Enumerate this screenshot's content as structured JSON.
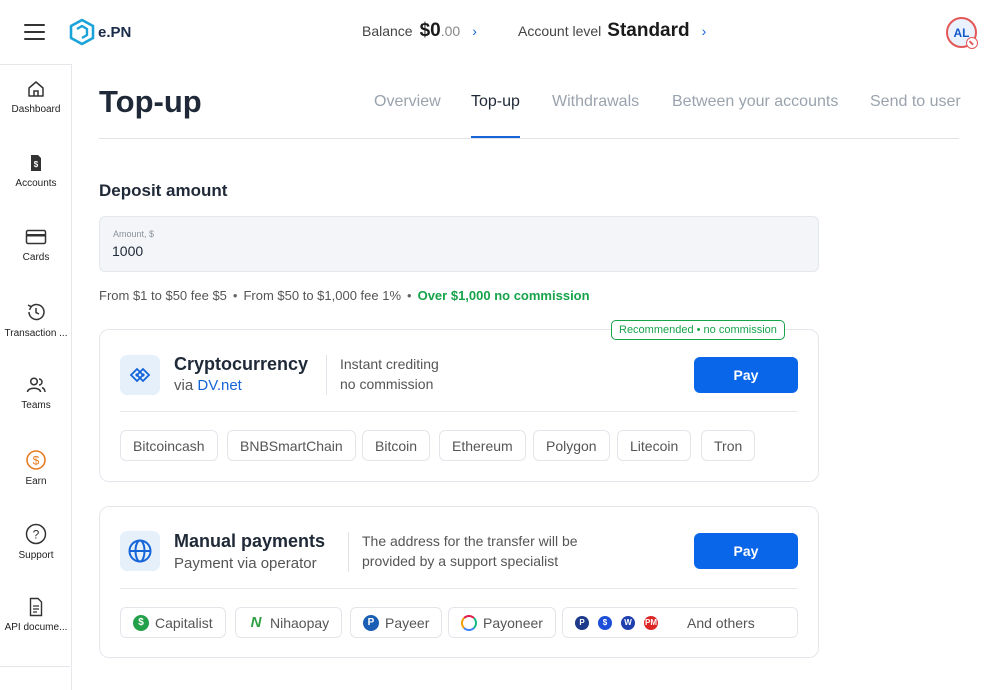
{
  "header": {
    "logo_text": "e.PN",
    "balance_label": "Balance",
    "balance_main": "$0",
    "balance_cents": ".00",
    "account_level_label": "Account level",
    "account_level_value": "Standard",
    "avatar_initials": "AL"
  },
  "sidebar": {
    "items": [
      {
        "label": "Dashboard",
        "icon": "home-icon"
      },
      {
        "label": "Accounts",
        "icon": "dollar-doc-icon"
      },
      {
        "label": "Cards",
        "icon": "card-icon"
      },
      {
        "label": "Transaction ...",
        "icon": "history-icon"
      },
      {
        "label": "Teams",
        "icon": "team-icon"
      },
      {
        "label": "Earn",
        "icon": "earn-dollar-icon"
      },
      {
        "label": "Support",
        "icon": "help-icon"
      },
      {
        "label": "API docume...",
        "icon": "document-icon"
      }
    ]
  },
  "page": {
    "title": "Top-up",
    "tabs": [
      "Overview",
      "Top-up",
      "Withdrawals",
      "Between your accounts",
      "Send to user"
    ],
    "active_tab": "Top-up"
  },
  "deposit": {
    "title": "Deposit amount",
    "amount_label": "Amount, $",
    "amount_value": "1000",
    "fee_1": "From $1 to $50 fee $5",
    "fee_2": "From $50 to $1,000 fee 1%",
    "fee_3": "Over $1,000 no commission"
  },
  "crypto": {
    "badge": "Recommended • no commission",
    "title": "Cryptocurrency",
    "via": "via",
    "via_link": "DV.net",
    "desc_1": "Instant crediting",
    "desc_2": "no commission",
    "pay_label": "Pay",
    "chips": [
      "Bitcoincash",
      "BNBSmartChain",
      "Bitcoin",
      "Ethereum",
      "Polygon",
      "Litecoin",
      "Tron"
    ]
  },
  "manual": {
    "title": "Manual payments",
    "subtitle": "Payment via operator",
    "desc_1": "The address for the transfer will be",
    "desc_2": "provided by a support specialist",
    "pay_label": "Pay",
    "chips": [
      "Capitalist",
      "Nihaopay",
      "Payeer",
      "Payoneer"
    ],
    "others_label": "And others"
  },
  "colors": {
    "accent": "#1565d8",
    "pay_button": "#0a66e8",
    "green": "#16a34a",
    "earn_orange": "#e67e22"
  }
}
